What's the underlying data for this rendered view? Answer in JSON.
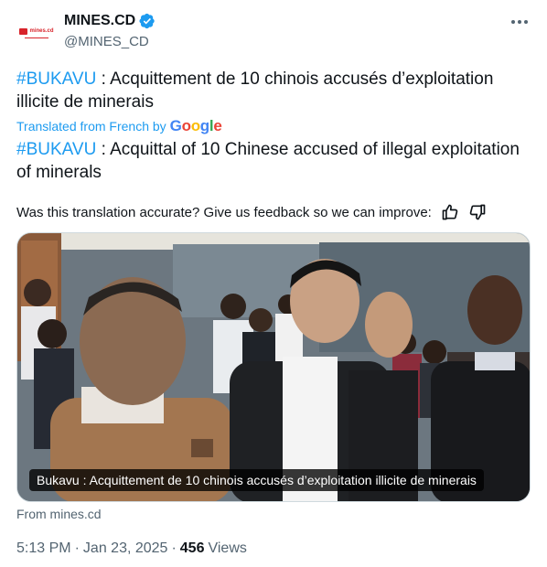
{
  "author": {
    "display_name": "MINES.CD",
    "handle": "@MINES_CD",
    "avatar_logo_text": "mines.cd",
    "verified_color": "#1d9bf0"
  },
  "tweet": {
    "fr_hashtag": "#BUKAVU",
    "fr_text": " : Acquittement de 10 chinois accusés d’exploitation illicite de minerais",
    "translated_label": "Translated from French by",
    "translated_by": "Google",
    "en_hashtag": "#BUKAVU",
    "en_text": " : Acquittal of 10 Chinese accused of illegal exploitation of minerals",
    "feedback_prompt": "Was this translation accurate? Give us feedback so we can improve:"
  },
  "media": {
    "caption": "Bukavu : Acquittement de 10 chinois accusés d’exploitation illicite de minerais",
    "source": "From mines.cd"
  },
  "meta": {
    "time": "5:13 PM",
    "date": "Jan 23, 2025",
    "separator": "·",
    "views_count": "456",
    "views_label": "Views"
  },
  "icons": {
    "more": "more-options-icon",
    "thumb_up": "thumb-up-icon",
    "thumb_down": "thumb-down-icon",
    "verified": "verified-badge-icon"
  },
  "colors": {
    "link": "#1d9bf0",
    "secondary_text": "#536471",
    "primary_text": "#0f1419",
    "brand_red": "#d8232a"
  }
}
